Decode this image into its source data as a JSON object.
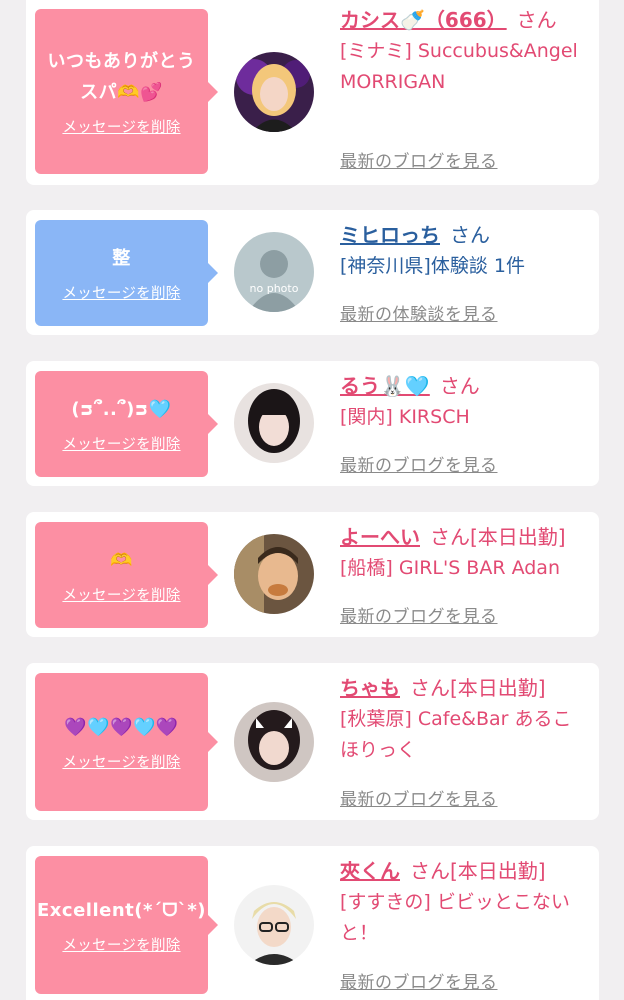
{
  "colors": {
    "pink": "#fc8fa3",
    "blue": "#8ab6f6",
    "name_pink": "#e24a73",
    "name_blue": "#2a5f9e",
    "link_gray": "#8a8a8a"
  },
  "cards": [
    {
      "bubble_text": "いつもありがとうスパ🫶💕",
      "delete_label": "メッセージを削除",
      "name": "カシス🍼（666）",
      "honorific": "さん",
      "shop": "[ミナミ] Succubus&Angel MORRIGAN",
      "link": "最新のブログを見る"
    },
    {
      "bubble_text": "整",
      "delete_label": "メッセージを削除",
      "name": "ミヒロっち",
      "honorific": "さん",
      "shop": "[神奈川県]体験談 1件",
      "link": "最新の体験談を見る",
      "avatar_text": "no photo"
    },
    {
      "bubble_text": "(ᴝ՞..՞)ᴝ🩵",
      "delete_label": "メッセージを削除",
      "name": "るう🐰🩵",
      "honorific": "さん",
      "shop": "[関内] KIRSCH",
      "link": "最新のブログを見る"
    },
    {
      "bubble_text": "🫶",
      "delete_label": "メッセージを削除",
      "name": "よーへい",
      "honorific": "さん[本日出勤]",
      "shop": "[船橋] GIRL'S BAR Adan",
      "link": "最新のブログを見る"
    },
    {
      "bubble_text": "💜🩵💜🩵💜",
      "delete_label": "メッセージを削除",
      "name": "ちゃも",
      "honorific": "さん[本日出勤]",
      "shop": "[秋葉原] Cafe&Bar あるこほりっく",
      "link": "最新のブログを見る"
    },
    {
      "bubble_text": "Excellent(*ˊᗜˋ*)",
      "delete_label": "メッセージを削除",
      "name": "夾くん",
      "honorific": "さん[本日出勤]",
      "shop": "[すすきの] ビビッとこないと！",
      "link": "最新のブログを見る"
    }
  ]
}
